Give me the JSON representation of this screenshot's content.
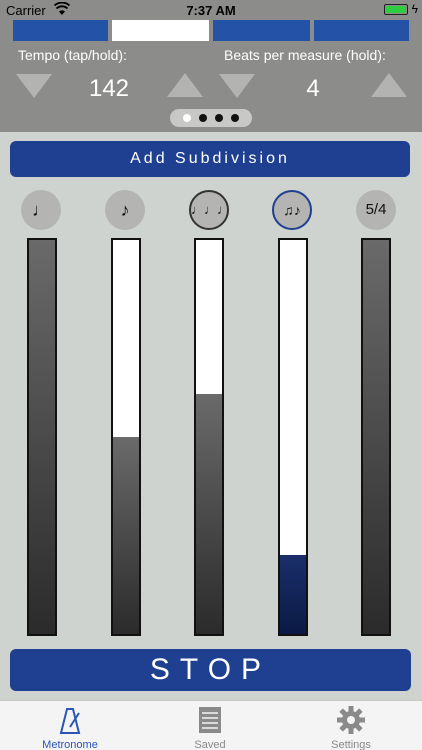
{
  "status_bar": {
    "carrier": "Carrier",
    "time": "7:37 AM"
  },
  "header": {
    "beat_boxes": [
      {
        "color": "#2352a6"
      },
      {
        "color": "#ffffff"
      },
      {
        "color": "#2352a6"
      },
      {
        "color": "#2352a6"
      }
    ],
    "tempo_label": "Tempo (tap/hold):",
    "tempo_value": "142",
    "beats_label": "Beats per measure (hold):",
    "beats_value": "4",
    "page_dots": 4,
    "active_page": 0
  },
  "add_subdivision_label": "Add Subdivision",
  "subdivisions": [
    {
      "icon": "quarter-note-icon",
      "glyph": "♩",
      "level": 1.0
    },
    {
      "icon": "eighth-note-icon",
      "glyph": "♪",
      "level": 0.5
    },
    {
      "icon": "quarter-triplet-icon",
      "glyph": "♩♩♩",
      "level": 0.61
    },
    {
      "icon": "eighth-triplet-icon",
      "glyph": "♫♪",
      "level": 0.2
    },
    {
      "icon": "five-four-icon",
      "glyph": "5/4",
      "level": 1.0
    }
  ],
  "stop_label": "STOP",
  "tabs": [
    {
      "label": "Metronome",
      "icon": "metronome-icon",
      "active": true
    },
    {
      "label": "Saved",
      "icon": "document-icon",
      "active": false
    },
    {
      "label": "Settings",
      "icon": "gear-icon",
      "active": false
    }
  ],
  "colors": {
    "accent": "#1f3f91",
    "active_tab": "#2a55b5"
  }
}
